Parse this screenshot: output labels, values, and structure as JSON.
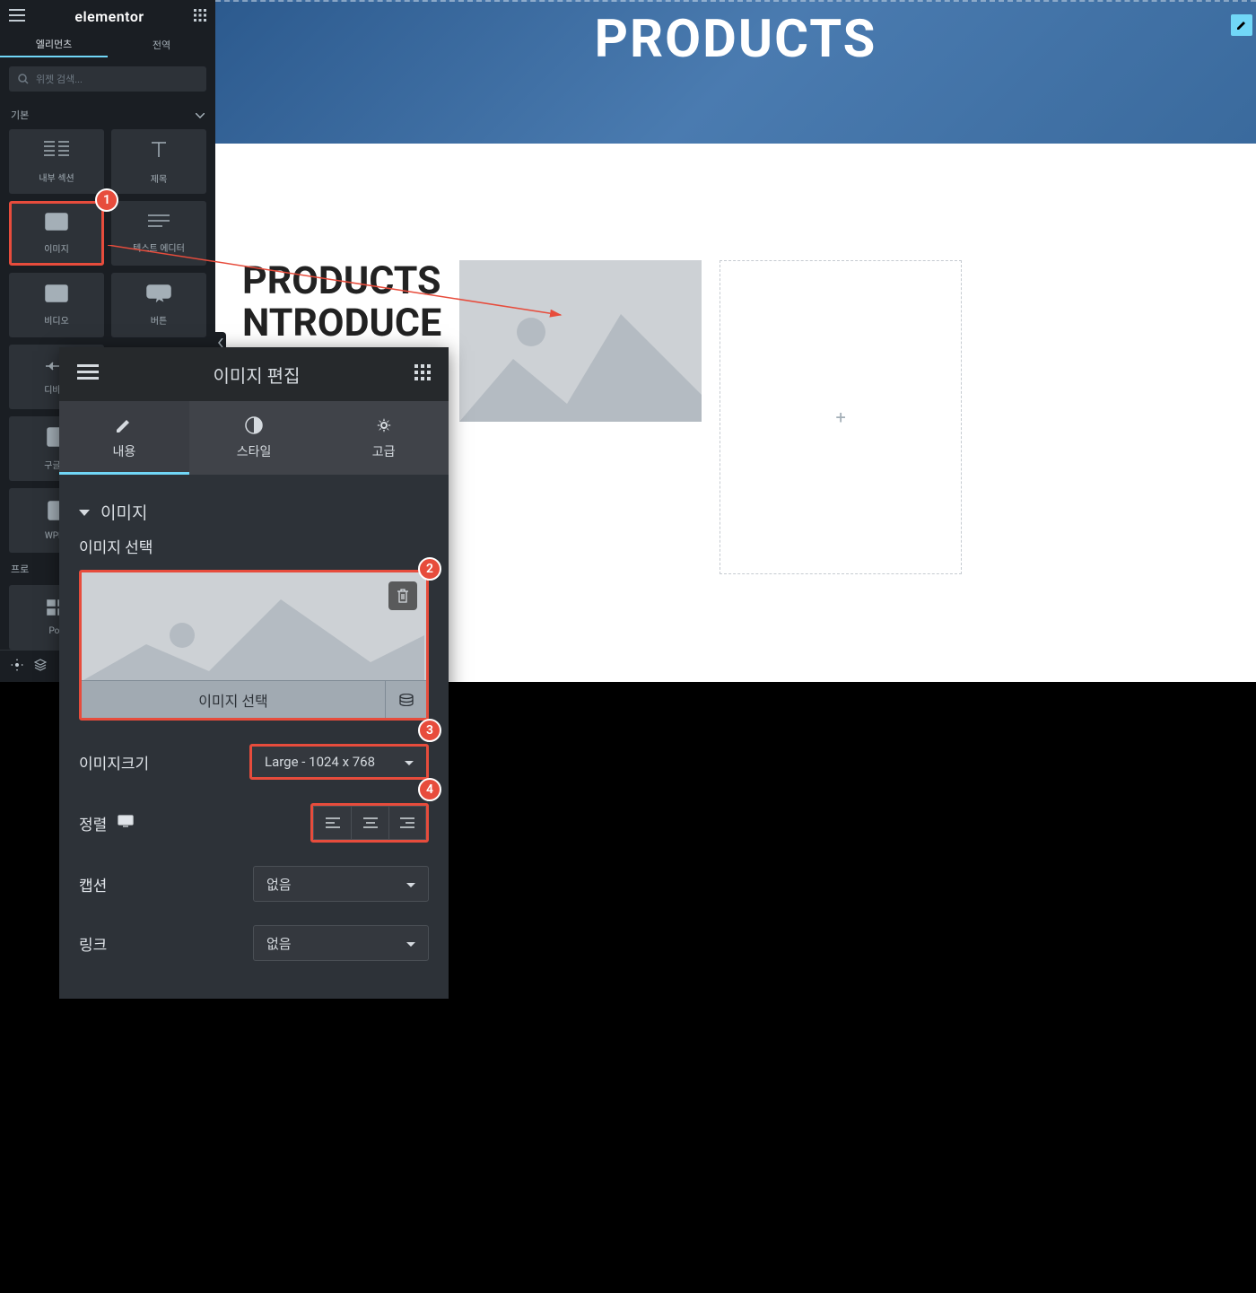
{
  "header": {
    "logo": "elementor"
  },
  "sidebar": {
    "tabs": [
      {
        "label": "엘리먼츠",
        "active": true
      },
      {
        "label": "전역",
        "active": false
      }
    ],
    "search_placeholder": "위젯 검색...",
    "category": "기본",
    "widgets": [
      {
        "label": "내부 섹션",
        "icon": "columns"
      },
      {
        "label": "제목",
        "icon": "heading"
      },
      {
        "label": "이미지",
        "icon": "image",
        "highlighted": true
      },
      {
        "label": "텍스트 에디터",
        "icon": "text"
      },
      {
        "label": "비디오",
        "icon": "video"
      },
      {
        "label": "버튼",
        "icon": "button"
      },
      {
        "label": "디바이",
        "icon": "divider"
      },
      {
        "label": "구글지",
        "icon": "map"
      },
      {
        "label": "WPFo",
        "icon": "form"
      }
    ],
    "pro_label": "프로",
    "post_label": "Pos"
  },
  "content": {
    "hero_title": "PRODUCTS",
    "heading_line1": "PRODUCTS",
    "heading_line2": "NTRODUCE"
  },
  "editor": {
    "title": "이미지 편집",
    "tabs": [
      {
        "label": "내용",
        "icon": "pencil",
        "active": true
      },
      {
        "label": "스타일",
        "icon": "contrast",
        "active": false
      },
      {
        "label": "고급",
        "icon": "gear",
        "active": false
      }
    ],
    "section_title": "이미지",
    "controls": {
      "choose_image_label": "이미지 선택",
      "choose_image_button": "이미지 선택",
      "image_size_label": "이미지크기",
      "image_size_value": "Large - 1024 x 768",
      "alignment_label": "정렬",
      "caption_label": "캡션",
      "caption_value": "없음",
      "link_label": "링크",
      "link_value": "없음"
    }
  },
  "markers": {
    "m1": "1",
    "m2": "2",
    "m3": "3",
    "m4": "4"
  }
}
